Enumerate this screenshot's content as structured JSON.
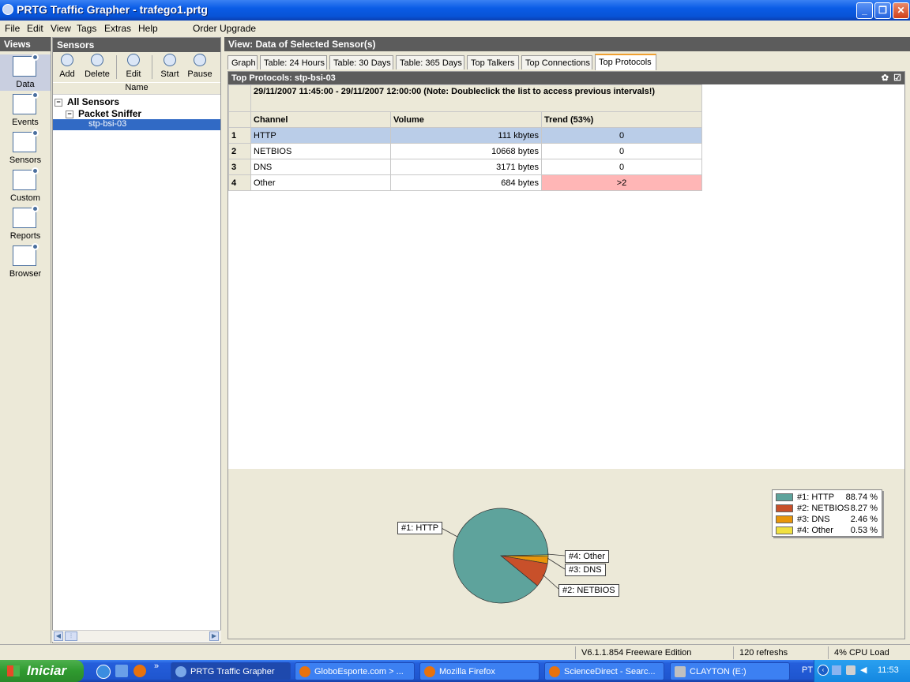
{
  "window": {
    "title": "PRTG Traffic Grapher - trafego1.prtg"
  },
  "menu": [
    "File",
    "Edit",
    "View",
    "Tags",
    "Extras",
    "Help",
    "Order Upgrade"
  ],
  "views_panel": {
    "header": "Views",
    "items": [
      {
        "label": "Data",
        "icon": "data-icon"
      },
      {
        "label": "Events",
        "icon": "events-icon"
      },
      {
        "label": "Sensors",
        "icon": "sensors-icon"
      },
      {
        "label": "Custom",
        "icon": "custom-icon"
      },
      {
        "label": "Reports",
        "icon": "reports-icon"
      },
      {
        "label": "Browser",
        "icon": "browser-icon"
      }
    ]
  },
  "sensors_panel": {
    "header": "Sensors",
    "toolbar": [
      "Add",
      "Delete",
      "Edit",
      "Start",
      "Pause"
    ],
    "column_header": "Name",
    "tree": {
      "root": "All Sensors",
      "group": "Packet Sniffer",
      "sensor": "stp-bsi-03"
    }
  },
  "main": {
    "header": "View: Data of Selected Sensor(s)",
    "tabs": [
      "Graph",
      "Table: 24 Hours",
      "Table: 30 Days",
      "Table: 365 Days",
      "Top Talkers",
      "Top Connections",
      "Top Protocols"
    ],
    "active_tab": "Top Protocols",
    "content_title": "Top Protocols: stp-bsi-03",
    "interval": "29/11/2007 11:45:00 - 29/11/2007 12:00:00 (Note: Doubleclick the list to access previous intervals!)",
    "columns": [
      "Channel",
      "Volume",
      "Trend (53%)"
    ],
    "rows": [
      {
        "n": "1",
        "channel": "HTTP",
        "volume": "111 kbytes",
        "trend": "0",
        "highlight": "#bacde8"
      },
      {
        "n": "2",
        "channel": "NETBIOS",
        "volume": "10668 bytes",
        "trend": "0",
        "highlight": "#ffffff"
      },
      {
        "n": "3",
        "channel": "DNS",
        "volume": "3171 bytes",
        "trend": "0",
        "highlight": "#ffffff"
      },
      {
        "n": "4",
        "channel": "Other",
        "volume": "684 bytes",
        "trend": ">2",
        "highlight": "#ffb6b6"
      }
    ]
  },
  "chart_data": {
    "type": "pie",
    "slices": [
      {
        "label": "#1: HTTP",
        "legend": "#1: HTTP",
        "value": 88.74,
        "pct_text": "88.74 %",
        "color": "#5ea39c"
      },
      {
        "label": "#2: NETBIOS",
        "legend": "#2: NETBIOS",
        "value": 8.27,
        "pct_text": "8.27 %",
        "color": "#c8502a"
      },
      {
        "label": "#3: DNS",
        "legend": "#3: DNS",
        "value": 2.46,
        "pct_text": "2.46 %",
        "color": "#e8960a"
      },
      {
        "label": "#4: Other",
        "legend": "#4: Other",
        "value": 0.53,
        "pct_text": "0.53 %",
        "color": "#f0e040"
      }
    ]
  },
  "statusbar": {
    "version": "V6.1.1.854 Freeware Edition",
    "refreshs": "120 refreshs",
    "cpu": "4% CPU Load"
  },
  "taskbar": {
    "start": "Iniciar",
    "buttons": [
      {
        "label": "PRTG Traffic Grapher",
        "active": true
      },
      {
        "label": "GloboEsporte.com > ...",
        "active": false
      },
      {
        "label": "Mozilla Firefox",
        "active": false
      },
      {
        "label": "ScienceDirect - Searc...",
        "active": false
      },
      {
        "label": "CLAYTON (E:)",
        "active": false
      }
    ],
    "lang": "PT",
    "time": "11:53"
  }
}
